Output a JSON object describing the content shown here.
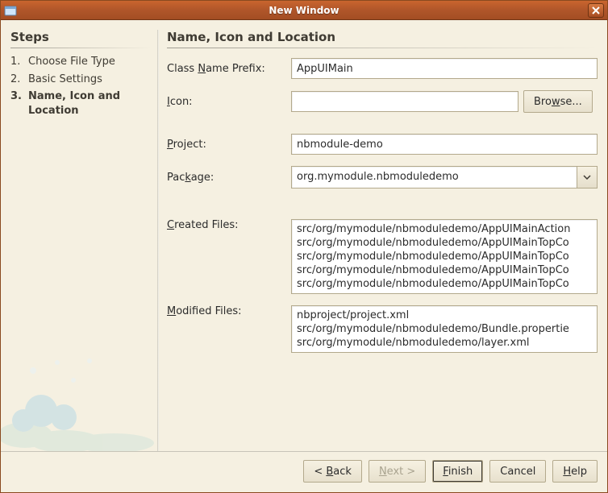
{
  "window": {
    "title": "New Window"
  },
  "steps": {
    "heading": "Steps",
    "items": [
      {
        "num": "1.",
        "label": "Choose File Type"
      },
      {
        "num": "2.",
        "label": "Basic Settings"
      },
      {
        "num": "3.",
        "label": "Name, Icon and Location"
      }
    ],
    "currentIndex": 2
  },
  "main": {
    "heading": "Name, Icon and Location",
    "classNamePrefix": {
      "label_pre": "Class ",
      "label_mn": "N",
      "label_post": "ame Prefix:",
      "value": "AppUIMain"
    },
    "icon": {
      "label_mn": "I",
      "label_post": "con:",
      "value": "",
      "browse_pre": "Bro",
      "browse_mn": "w",
      "browse_post": "se..."
    },
    "project": {
      "label_mn": "P",
      "label_post": "roject:",
      "value": "nbmodule-demo"
    },
    "package": {
      "label_pre": "Pac",
      "label_mn": "k",
      "label_post": "age:",
      "value": "org.mymodule.nbmoduledemo"
    },
    "createdFiles": {
      "label_mn": "C",
      "label_post": "reated Files:",
      "lines": [
        "src/org/mymodule/nbmoduledemo/AppUIMainAction",
        "src/org/mymodule/nbmoduledemo/AppUIMainTopCo",
        "src/org/mymodule/nbmoduledemo/AppUIMainTopCo",
        "src/org/mymodule/nbmoduledemo/AppUIMainTopCo",
        "src/org/mymodule/nbmoduledemo/AppUIMainTopCo"
      ]
    },
    "modifiedFiles": {
      "label_mn": "M",
      "label_post": "odified Files:",
      "lines": [
        "nbproject/project.xml",
        "src/org/mymodule/nbmoduledemo/Bundle.propertie",
        "src/org/mymodule/nbmoduledemo/layer.xml"
      ]
    }
  },
  "buttons": {
    "back_pre": "< ",
    "back_mn": "B",
    "back_post": "ack",
    "next_mn": "N",
    "next_post": "ext >",
    "finish_mn": "F",
    "finish_post": "inish",
    "cancel": "Cancel",
    "help_mn": "H",
    "help_post": "elp"
  }
}
